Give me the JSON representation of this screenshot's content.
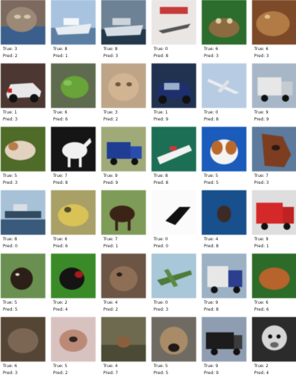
{
  "items": [
    {
      "true": "True: 3",
      "pred": "Pred: 2",
      "subject": "cat"
    },
    {
      "true": "True: 8",
      "pred": "Pred: 1",
      "subject": "ship"
    },
    {
      "true": "True: 8",
      "pred": "Pred: 3",
      "subject": "ship"
    },
    {
      "true": "True: 0",
      "pred": "Pred: 8",
      "subject": "airplane"
    },
    {
      "true": "True: 6",
      "pred": "Pred: 3",
      "subject": "frog"
    },
    {
      "true": "True: 6",
      "pred": "Pred: 3",
      "subject": "frog"
    },
    {
      "true": "True: 1",
      "pred": "Pred: 3",
      "subject": "automobile"
    },
    {
      "true": "True: 6",
      "pred": "Pred: 6",
      "subject": "frog"
    },
    {
      "true": "True: 3",
      "pred": "Pred: 2",
      "subject": "cat"
    },
    {
      "true": "True: 1",
      "pred": "Pred: 9",
      "subject": "automobile"
    },
    {
      "true": "True: 0",
      "pred": "Pred: 8",
      "subject": "airplane"
    },
    {
      "true": "True: 9",
      "pred": "Pred: 9",
      "subject": "truck"
    },
    {
      "true": "True: 5",
      "pred": "Pred: 3",
      "subject": "dog"
    },
    {
      "true": "True: 7",
      "pred": "Pred: 8",
      "subject": "horse"
    },
    {
      "true": "True: 9",
      "pred": "Pred: 9",
      "subject": "truck"
    },
    {
      "true": "True: 8",
      "pred": "Pred: 8",
      "subject": "ship"
    },
    {
      "true": "True: 5",
      "pred": "Pred: 5",
      "subject": "dog"
    },
    {
      "true": "True: 7",
      "pred": "Pred: 3",
      "subject": "horse"
    },
    {
      "true": "True: 8",
      "pred": "Pred: 0",
      "subject": "ship"
    },
    {
      "true": "True: 6",
      "pred": "Pred: 6",
      "subject": "frog"
    },
    {
      "true": "True: 7",
      "pred": "Pred: 1",
      "subject": "horse"
    },
    {
      "true": "True: 0",
      "pred": "Pred: 0",
      "subject": "airplane"
    },
    {
      "true": "True: 4",
      "pred": "Pred: 8",
      "subject": "deer"
    },
    {
      "true": "True: 9",
      "pred": "Pred: 1",
      "subject": "truck"
    },
    {
      "true": "True: 5",
      "pred": "Pred: 5",
      "subject": "dog"
    },
    {
      "true": "True: 2",
      "pred": "Pred: 4",
      "subject": "bird"
    },
    {
      "true": "True: 4",
      "pred": "Pred: 2",
      "subject": "deer"
    },
    {
      "true": "True: 0",
      "pred": "Pred: 3",
      "subject": "airplane"
    },
    {
      "true": "True: 9",
      "pred": "Pred: 8",
      "subject": "truck"
    },
    {
      "true": "True: 6",
      "pred": "Pred: 6",
      "subject": "frog"
    },
    {
      "true": "True: 6",
      "pred": "Pred: 3",
      "subject": "frog"
    },
    {
      "true": "True: 5",
      "pred": "Pred: 2",
      "subject": "dog"
    },
    {
      "true": "True: 4",
      "pred": "Pred: 7",
      "subject": "deer"
    },
    {
      "true": "True: 5",
      "pred": "Pred: 5",
      "subject": "dog"
    },
    {
      "true": "True: 9",
      "pred": "Pred: 9",
      "subject": "truck"
    },
    {
      "true": "True: 2",
      "pred": "Pred: 4",
      "subject": "bird"
    }
  ]
}
